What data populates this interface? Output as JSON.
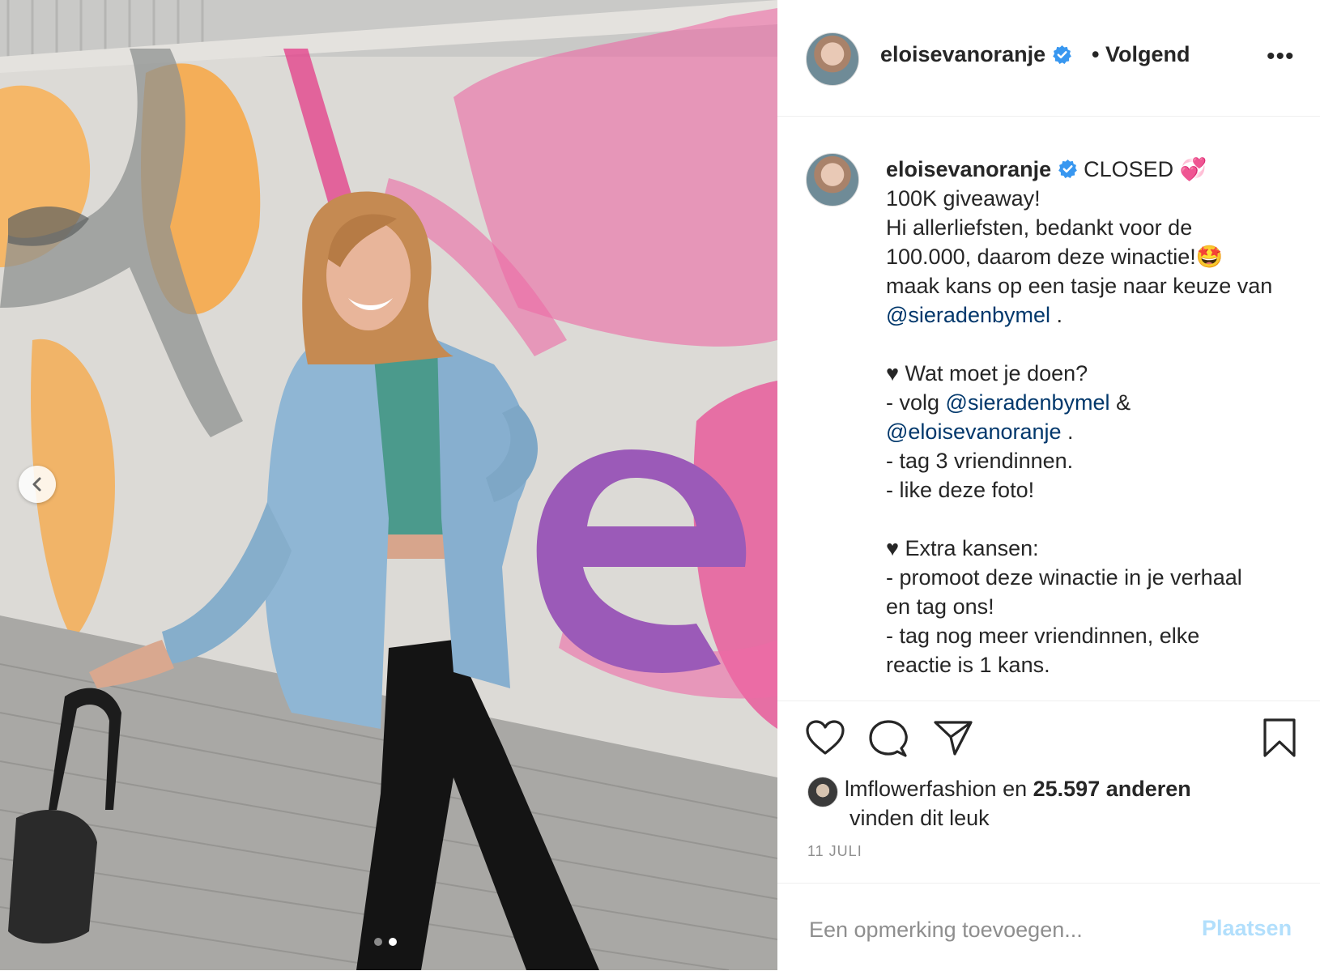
{
  "post": {
    "username": "eloisevanoranje",
    "follow_status": "• Volgend",
    "more_label": "•••"
  },
  "caption": {
    "username": "eloisevanoranje",
    "lines": [
      "CLOSED 💞",
      "100K giveaway!",
      "Hi allerliefsten, bedankt voor de",
      "100.000, daarom deze winactie!🤩",
      "maak kans op een tasje naar keuze van",
      "@sieradenbymel",
      " .",
      "♥ Wat moet je doen?",
      "- volg",
      "@sieradenbymel",
      " &",
      "@eloisevanoranje",
      " .",
      "- tag 3 vriendinnen.",
      "- like deze foto!",
      "♥ Extra kansen:",
      "- promoot deze winactie in je verhaal",
      "en tag ons!",
      "- tag nog meer vriendinnen, elke",
      "reactie is 1 kans."
    ]
  },
  "likes": {
    "user": "lmflowerfashion",
    "connector": " en ",
    "count": "25.597 anderen",
    "suffix": "vinden dit leuk"
  },
  "date": "11 JULI",
  "comment": {
    "placeholder": "Een opmerking toevoegen...",
    "post_label": "Plaatsen"
  },
  "colors": {
    "mention": "#00376b",
    "verified": "#3897f0",
    "post_button": "#b2dffc"
  },
  "icons": [
    "chevron-left-icon",
    "verified-badge-icon",
    "heart-icon",
    "comment-icon",
    "share-icon",
    "bookmark-icon",
    "more-options-icon"
  ],
  "carousel": {
    "total": 2,
    "active": 2
  }
}
